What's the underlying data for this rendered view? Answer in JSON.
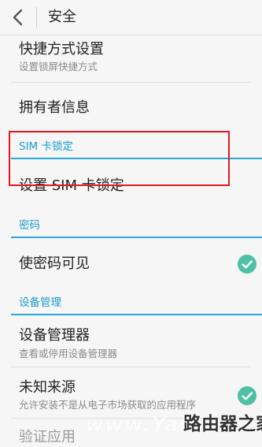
{
  "header": {
    "title": "安全"
  },
  "items": {
    "shortcut_title": "快捷方式设置",
    "shortcut_sub": "设置锁屏快捷方式",
    "owner_title": "拥有者信息",
    "sim_set_title": "设置 SIM 卡锁定",
    "password_visible_title": "使密码可见",
    "device_admin_title": "设备管理器",
    "device_admin_sub": "查看或停用设备管理器",
    "unknown_sources_title": "未知来源",
    "unknown_sources_sub": "允许安装不是从电子市场获取的应用程序",
    "verify_apps_title": "验证应用"
  },
  "sections": {
    "sim_lock": "SIM 卡锁定",
    "password": "密码",
    "device_management": "设备管理"
  },
  "toggles": {
    "password_visible": true,
    "unknown_sources": true
  },
  "colors": {
    "accent": "#1a9ccd",
    "check": "#4fc0a5",
    "highlight": "#e01a22"
  },
  "watermark": {
    "left": "www.YaO",
    "right": "路由器之家"
  }
}
